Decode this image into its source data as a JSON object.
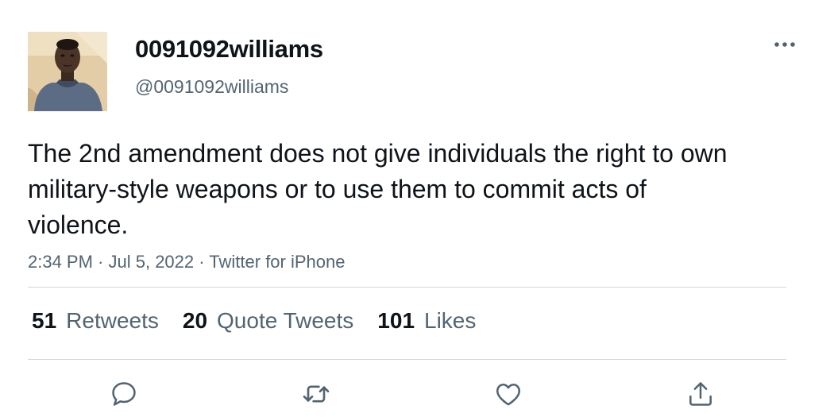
{
  "user": {
    "display_name": "0091092williams",
    "handle": "@0091092williams"
  },
  "tweet": {
    "text": "The 2nd amendment does not give individuals the right to own military-style weapons or to use them to commit acts of violence.",
    "time": "2:34 PM",
    "separator": " · ",
    "date": "Jul 5, 2022",
    "source": "Twitter for iPhone"
  },
  "stats": {
    "retweets_count": "51",
    "retweets_label": "Retweets",
    "quotes_count": "20",
    "quotes_label": "Quote Tweets",
    "likes_count": "101",
    "likes_label": "Likes"
  },
  "icons": {
    "more": "more-icon",
    "reply": "reply-icon",
    "retweet": "retweet-icon",
    "like": "like-icon",
    "share": "share-icon"
  },
  "colors": {
    "text_primary": "#0f1419",
    "text_secondary": "#536471",
    "divider": "#cfd9de"
  }
}
